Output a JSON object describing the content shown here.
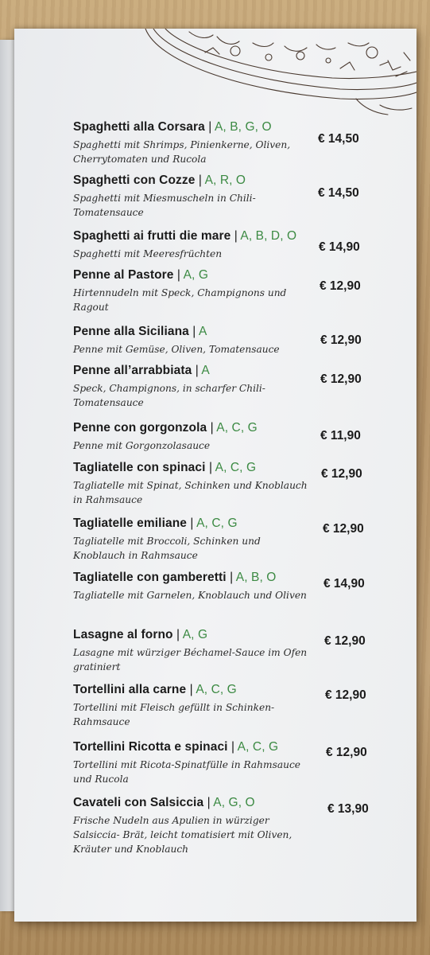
{
  "menu": {
    "dishes": [
      {
        "name": "Spaghetti alla Corsara",
        "sep": " | ",
        "allergens": "A, B, G, O",
        "price": "€ 14,50",
        "description": "Spaghetti mit Shrimps, Pinienkerne, Oliven, Cherrytomaten und Rucola"
      },
      {
        "name": "Spaghetti con Cozze",
        "sep": " | ",
        "allergens": "A, R, O",
        "price": "€ 14,50",
        "description": "Spaghetti mit Miesmuscheln in Chili-Tomatensauce"
      },
      {
        "name": "Spaghetti ai frutti die mare",
        "sep": " | ",
        "allergens": "A, B, D, O",
        "price": "€ 14,90",
        "description": "Spaghetti mit Meeresfrüchten"
      },
      {
        "name": "Penne al Pastore",
        "sep": " | ",
        "allergens": "A, G",
        "price": "€ 12,90",
        "description": "Hirtennudeln mit Speck, Champignons und Ragout"
      },
      {
        "name": "Penne alla Siciliana",
        "sep": " | ",
        "allergens": "A",
        "price": "€ 12,90",
        "description": "Penne mit Gemüse, Oliven, Tomatensauce"
      },
      {
        "name": "Penne all’arrabbiata",
        "sep": " | ",
        "allergens": "A",
        "price": "€ 12,90",
        "description": "Speck, Champignons, in scharfer Chili-Tomatensauce"
      },
      {
        "name": "Penne con gorgonzola",
        "sep": " | ",
        "allergens": "A, C, G",
        "price": "€ 11,90",
        "description": "Penne mit Gorgonzolasauce"
      },
      {
        "name": "Tagliatelle con spinaci",
        "sep": " | ",
        "allergens": "A, C, G",
        "price": "€ 12,90",
        "description": "Tagliatelle mit Spinat, Schinken und Knoblauch in Rahmsauce"
      },
      {
        "name": "Tagliatelle emiliane",
        "sep": " | ",
        "allergens": "A, C, G",
        "price": "€ 12,90",
        "description": "Tagliatelle mit Broccoli, Schinken und Knoblauch in Rahmsauce"
      },
      {
        "name": "Tagliatelle con gamberetti",
        "sep": " | ",
        "allergens": "A, B, O",
        "price": "€ 14,90",
        "description": "Tagliatelle mit Garnelen, Knoblauch und Oliven"
      },
      {
        "name": "Lasagne al forno",
        "sep": " | ",
        "allergens": "A, G",
        "price": "€ 12,90",
        "description": "Lasagne mit würziger Béchamel-Sauce im Ofen gratiniert"
      },
      {
        "name": "Tortellini alla carne",
        "sep": " | ",
        "allergens": "A, C, G",
        "price": "€ 12,90",
        "description": "Tortellini mit Fleisch gefüllt in Schinken-Rahmsauce"
      },
      {
        "name": "Tortellini Ricotta e spinaci",
        "sep": " | ",
        "allergens": "A, C, G",
        "price": "€ 12,90",
        "description": "Tortellini mit Ricota-Spinatfülle in Rahmsauce und Rucola"
      },
      {
        "name": "Cavateli con Salsiccia",
        "sep": " | ",
        "allergens": "A, G, O",
        "price": "€ 13,90",
        "description": "Frische Nudeln aus Apulien in würziger Salsiccia- Brät, leicht tomatisiert mit Oliven, Kräuter und Knoblauch"
      }
    ]
  },
  "colors": {
    "allergen_green": "#3c8a43",
    "page": "#eef0f2",
    "table_wood": "#b8966a"
  },
  "icons": {
    "illustration": "pizza-sketch-illustration"
  }
}
